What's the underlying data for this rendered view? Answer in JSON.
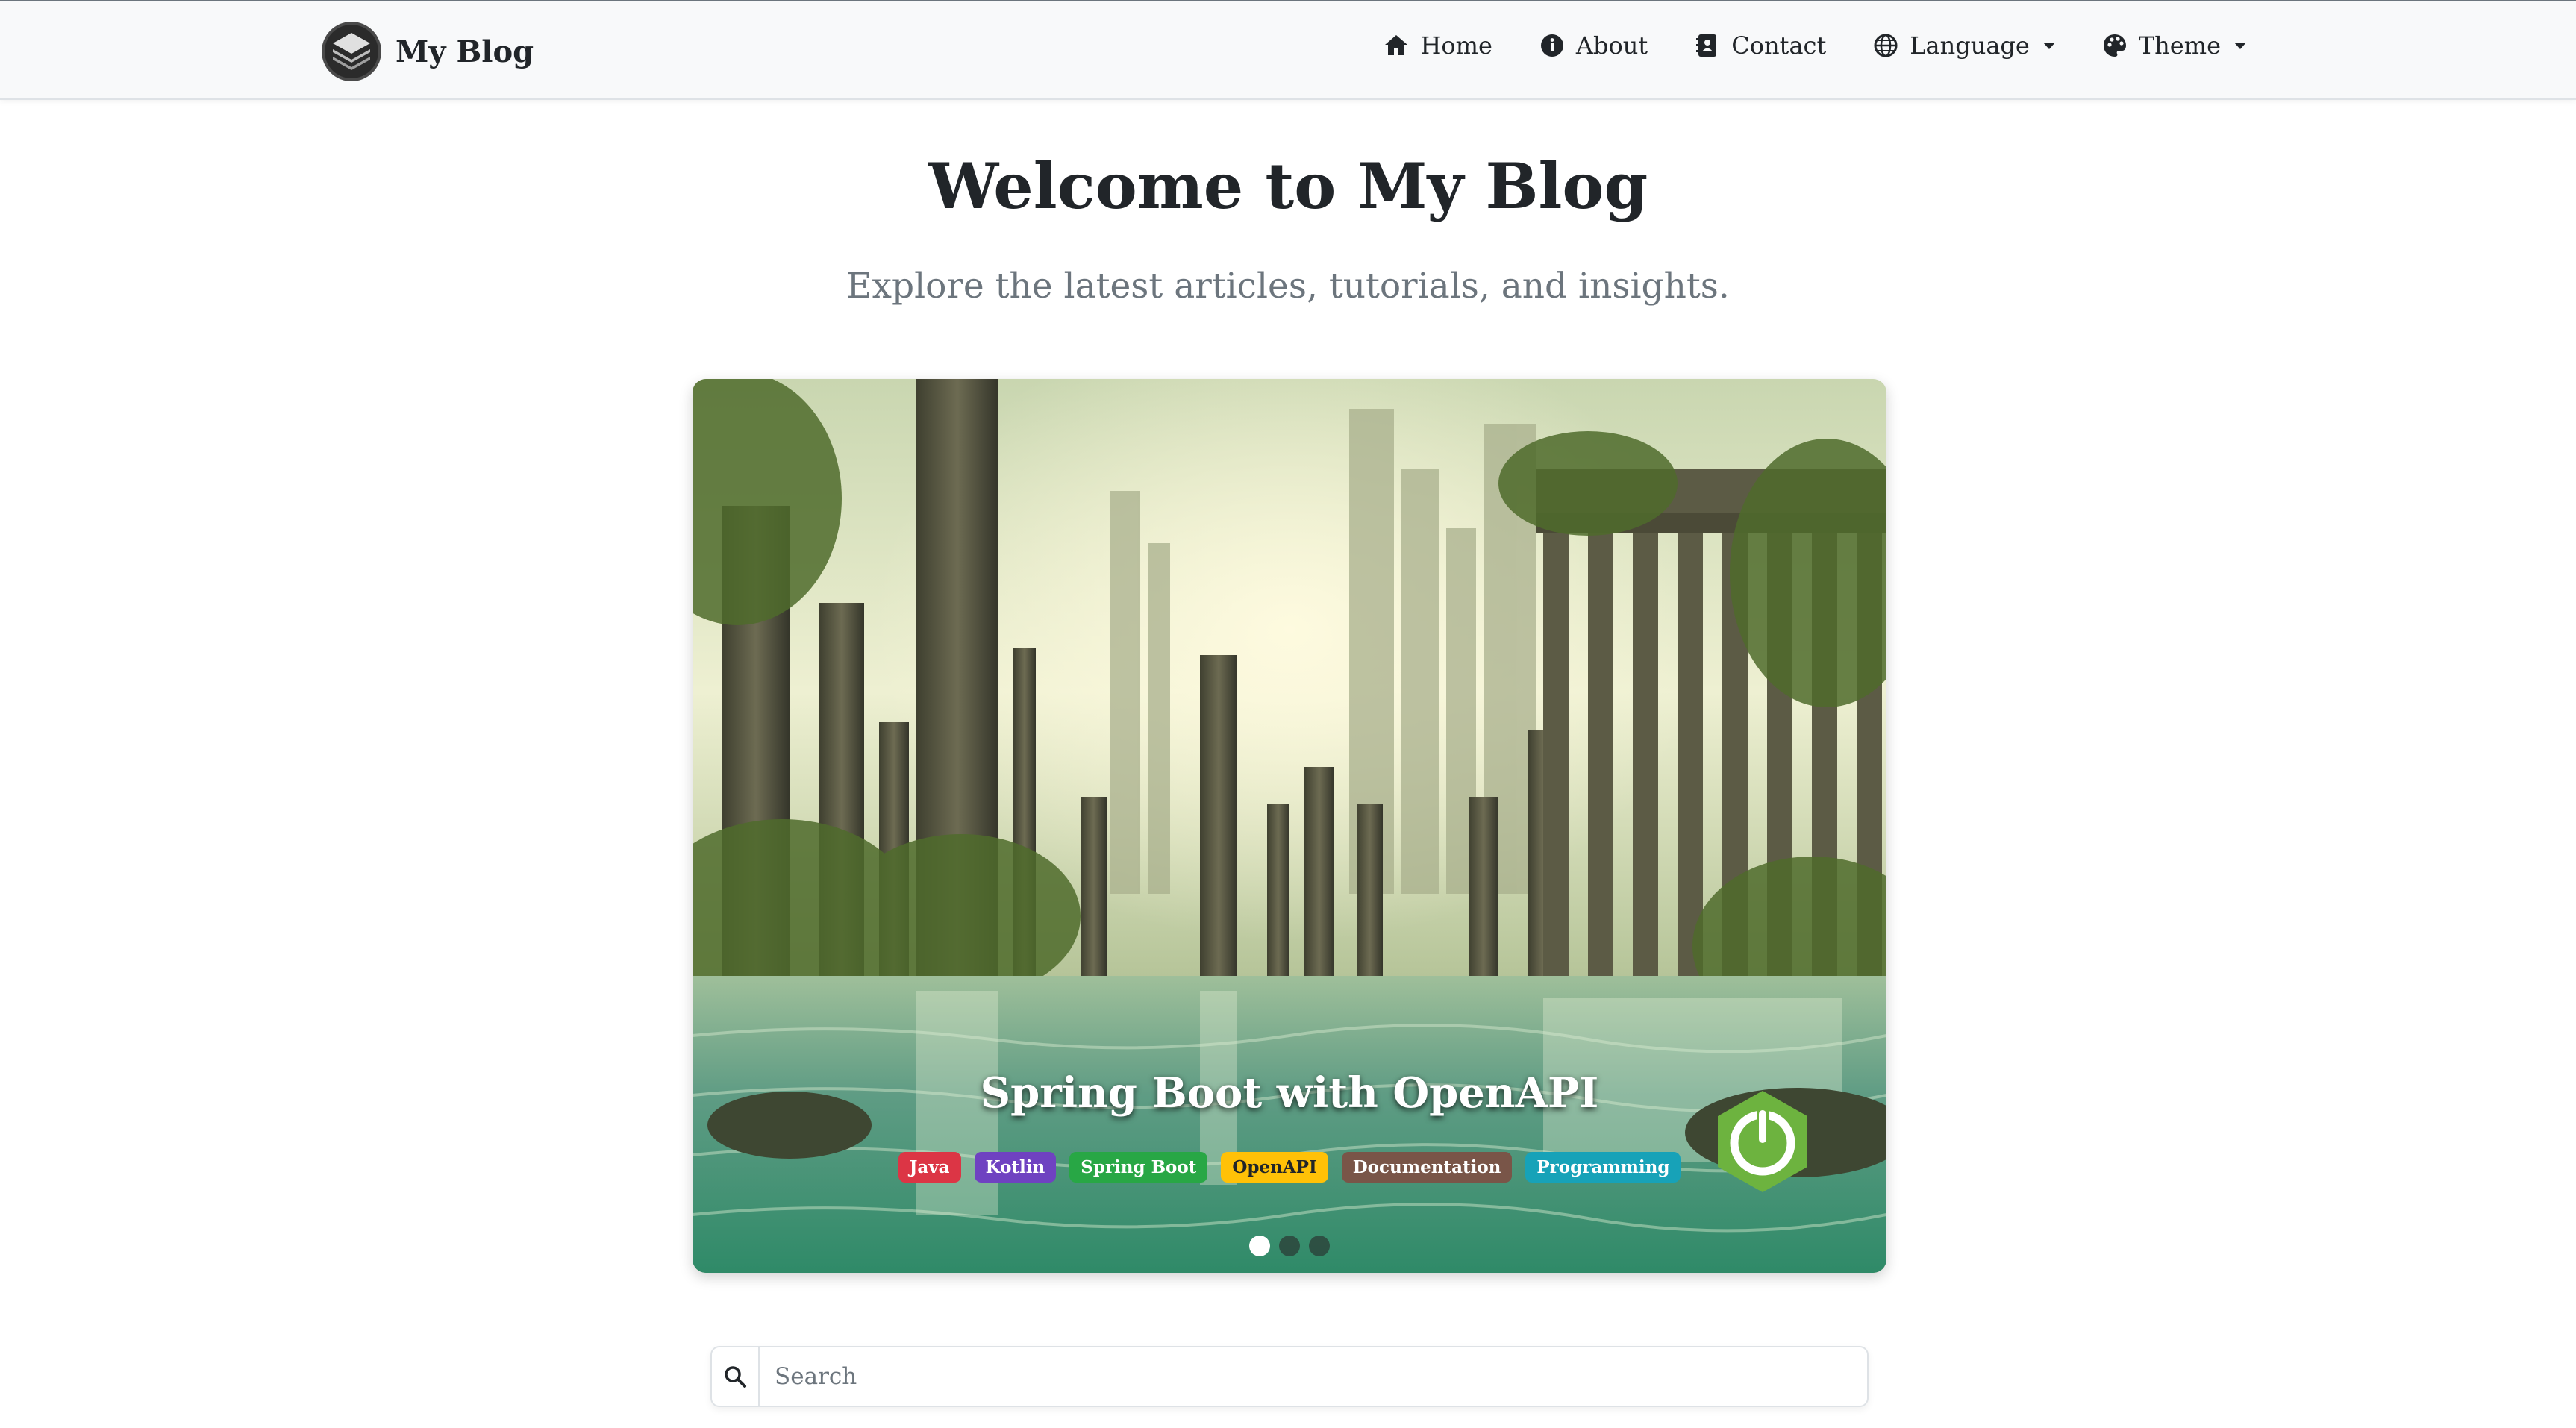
{
  "brand": {
    "name": "My Blog",
    "logo_icon": "stacked-layers-logo"
  },
  "nav": {
    "home": "Home",
    "about": "About",
    "contact": "Contact",
    "language": "Language",
    "theme": "Theme"
  },
  "hero": {
    "title": "Welcome to My Blog",
    "subtitle": "Explore the latest articles, tutorials, and insights."
  },
  "carousel": {
    "caption": "Spring Boot with OpenAPI",
    "tags": [
      {
        "label": "Java",
        "color": "#dc3545"
      },
      {
        "label": "Kotlin",
        "color": "#6f42c1"
      },
      {
        "label": "Spring Boot",
        "color": "#28a745"
      },
      {
        "label": "OpenAPI",
        "color": "#ffc107"
      },
      {
        "label": "Documentation",
        "color": "#795548"
      },
      {
        "label": "Programming",
        "color": "#17a2b8"
      }
    ],
    "slide_count": 3,
    "active_slide": 1
  },
  "search": {
    "placeholder": "Search"
  }
}
